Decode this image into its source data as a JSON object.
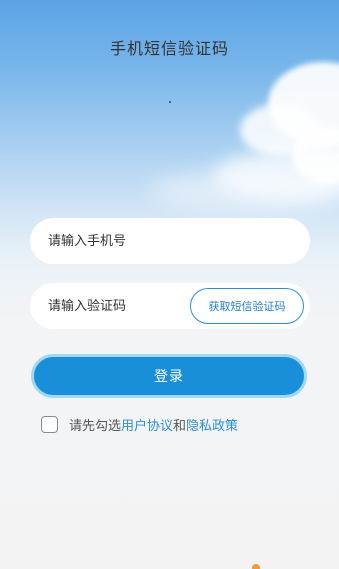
{
  "page": {
    "title": "手机短信验证码"
  },
  "form": {
    "phone_placeholder": "请输入手机号",
    "code_placeholder": "请输入验证码",
    "sms_button_label": "获取短信验证码",
    "login_button_label": "登录"
  },
  "agreement": {
    "prefix": "请先勾选",
    "user_agreement_link": "用户协议",
    "conjunction": "和",
    "privacy_policy_link": "隐私政策",
    "checked": false
  },
  "colors": {
    "accent": "#1a8fd9",
    "link": "#2a8fd5"
  }
}
